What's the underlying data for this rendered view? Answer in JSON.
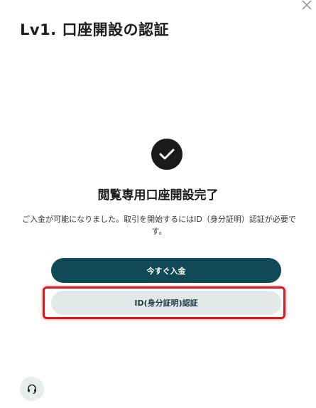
{
  "modal": {
    "title": "Lv1. 口座開設の認証",
    "close_icon": "close-icon"
  },
  "status": {
    "icon": "check-circle-icon",
    "heading": "閲覧専用口座開設完了",
    "message": "ご入金が可能になりました。取引を開始するにはID（身分証明）認証が必要です。"
  },
  "actions": {
    "deposit_label": "今すぐ入金",
    "id_verify_label": "ID(身分証明)認証"
  },
  "support": {
    "icon": "headset-icon"
  },
  "colors": {
    "primary": "#0f4a56",
    "secondary_bg": "#e3e8e8",
    "highlight": "#e0161b"
  }
}
